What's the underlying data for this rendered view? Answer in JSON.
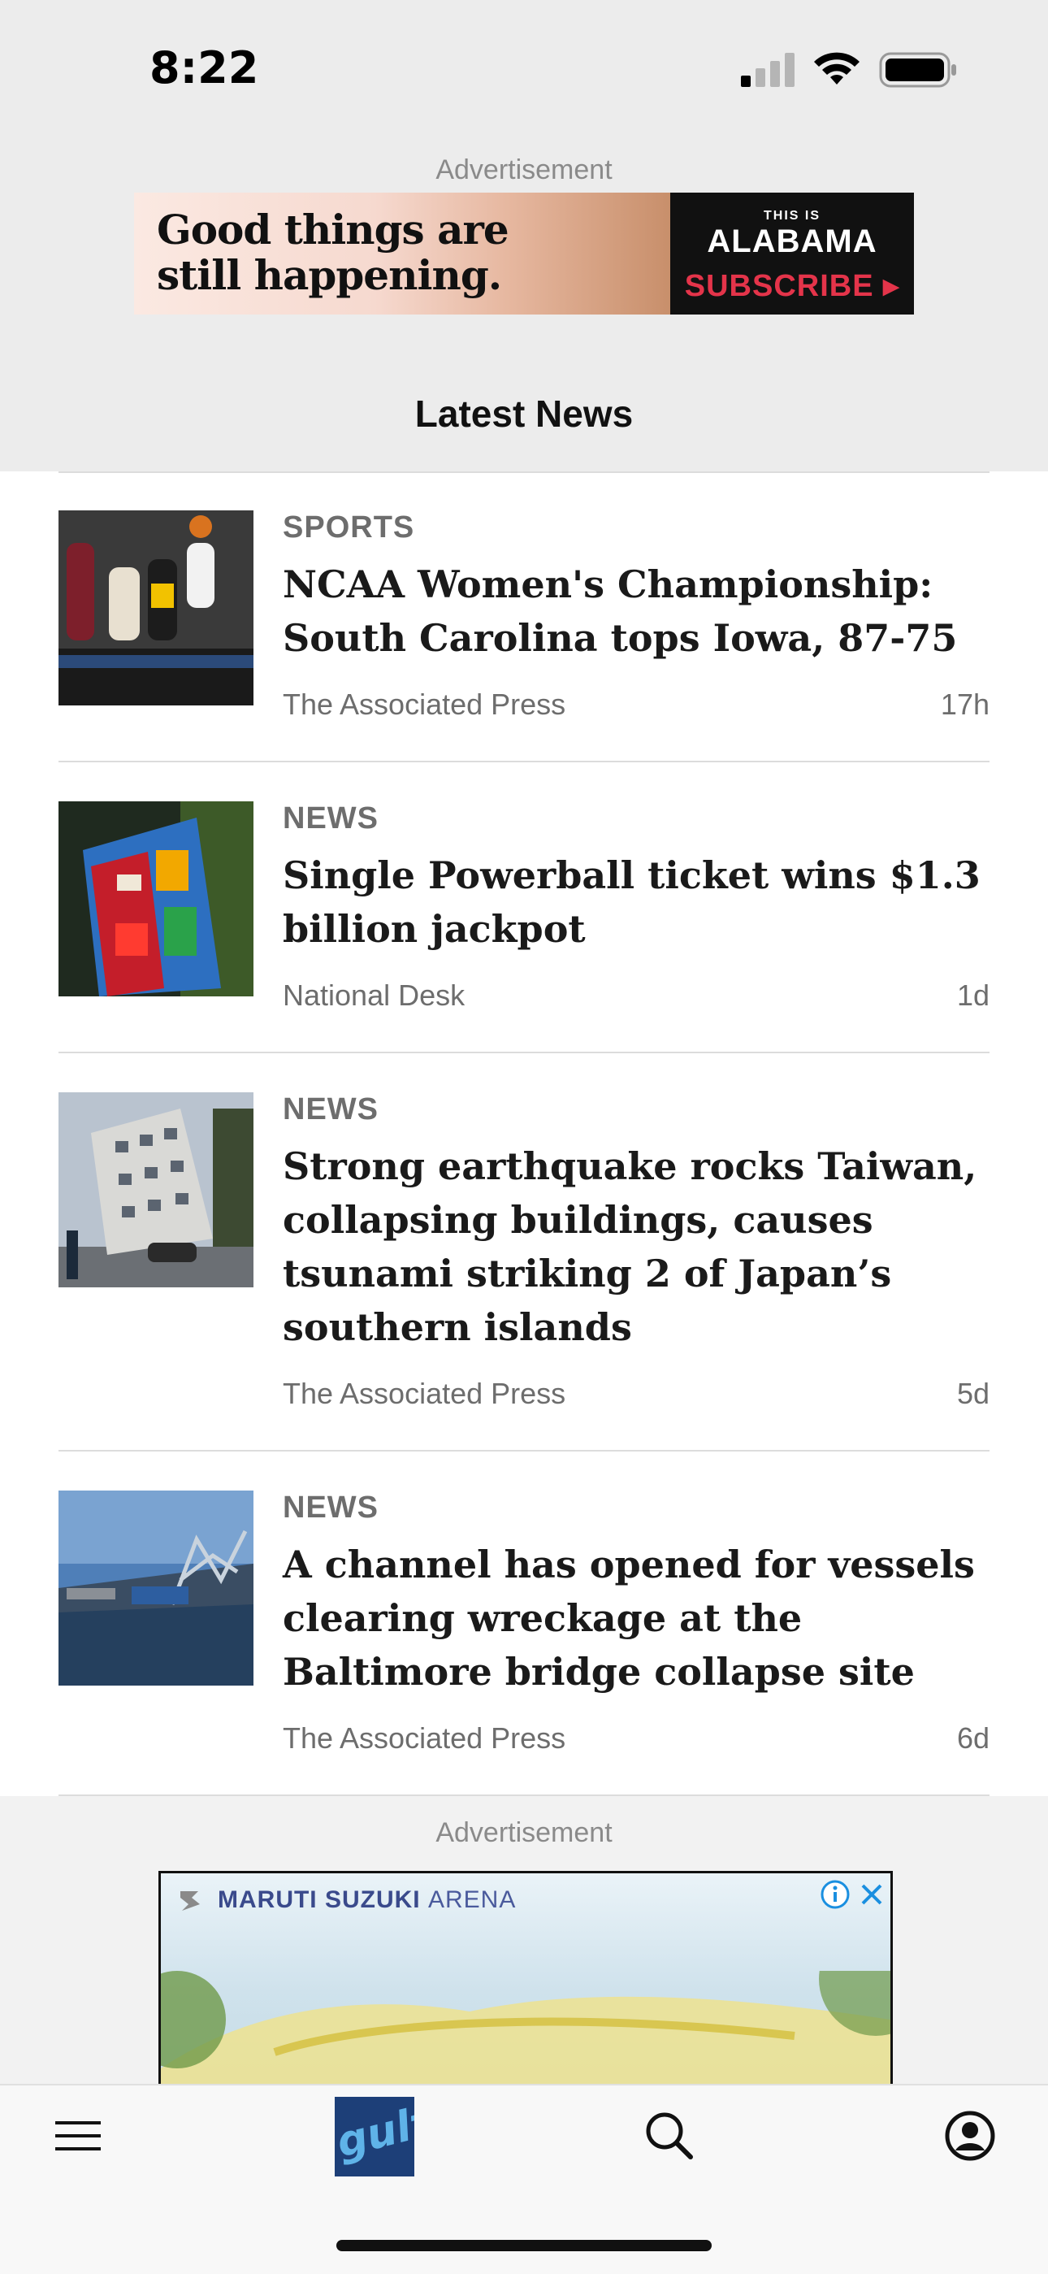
{
  "status_bar": {
    "time": "8:22",
    "signal_icon": "cellular-signal-icon",
    "wifi_icon": "wifi-icon",
    "battery_icon": "battery-icon"
  },
  "top_ad": {
    "label": "Advertisement",
    "headline_line1": "Good things are",
    "headline_line2": "still happening.",
    "brand_small": "THIS IS",
    "brand": "ALABAMA",
    "cta": "SUBSCRIBE ▸"
  },
  "section": {
    "title": "Latest News"
  },
  "articles": [
    {
      "category": "SPORTS",
      "headline": "NCAA Women's Championship: South Carolina tops Iowa, 87-75",
      "source": "The Associated Press",
      "age": "17h",
      "thumb_icon": "basketball-photo"
    },
    {
      "category": "NEWS",
      "headline": "Single Powerball ticket wins $1.3 billion jackpot",
      "source": "National Desk",
      "age": "1d",
      "thumb_icon": "powerball-sign-photo"
    },
    {
      "category": "NEWS",
      "headline": "Strong earthquake rocks Taiwan, collapsing buildings, causes tsunami striking 2 of Japan’s southern islands",
      "source": "The Associated Press",
      "age": "5d",
      "thumb_icon": "tilted-building-photo"
    },
    {
      "category": "NEWS",
      "headline": "A channel has opened for vessels clearing wreckage at the Baltimore bridge collapse site",
      "source": "The Associated Press",
      "age": "6d",
      "thumb_icon": "bridge-wreckage-photo"
    }
  ],
  "bottom_ad": {
    "label": "Advertisement",
    "brand": "MARUTI SUZUKI",
    "brand_suffix": "ARENA"
  },
  "tab_bar": {
    "menu_icon": "hamburger-menu-icon",
    "logo_text": "gulf",
    "search_icon": "search-icon",
    "account_icon": "account-icon"
  }
}
